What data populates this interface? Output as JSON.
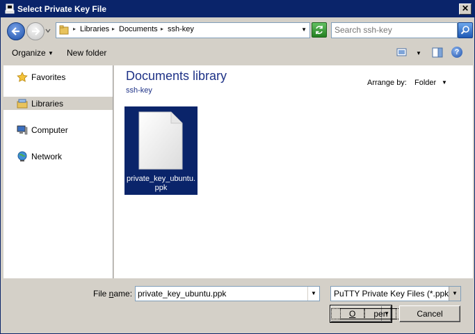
{
  "window": {
    "title": "Select Private Key File",
    "close_label": "✕"
  },
  "navbar": {
    "breadcrumbs": [
      "Libraries",
      "Documents",
      "ssh-key"
    ],
    "search_placeholder": "Search ssh-key"
  },
  "toolbar": {
    "organize_label": "Organize",
    "new_folder_label": "New folder",
    "help_label": "?"
  },
  "sidebar": {
    "items": [
      {
        "label": "Favorites",
        "icon": "star-icon",
        "selected": false
      },
      {
        "label": "Libraries",
        "icon": "libraries-icon",
        "selected": true
      },
      {
        "label": "Computer",
        "icon": "computer-icon",
        "selected": false
      },
      {
        "label": "Network",
        "icon": "network-icon",
        "selected": false
      }
    ]
  },
  "content": {
    "library_title": "Documents library",
    "library_subtitle": "ssh-key",
    "arrange_label": "Arrange by:",
    "arrange_value": "Folder",
    "files": [
      {
        "name": "private_key_ubuntu.ppk",
        "selected": true
      }
    ]
  },
  "footer": {
    "file_name_label_pre": "File ",
    "file_name_label_accel": "n",
    "file_name_label_post": "ame:",
    "file_name_value": "private_key_ubuntu.ppk",
    "filter_value": "PuTTY Private Key Files (*.ppk)",
    "open_label_accel": "O",
    "open_label_rest": "pen",
    "cancel_label": "Cancel"
  },
  "colors": {
    "titlebar": "#0a246a",
    "selection": "#0a246a",
    "library_title": "#1e3287"
  }
}
